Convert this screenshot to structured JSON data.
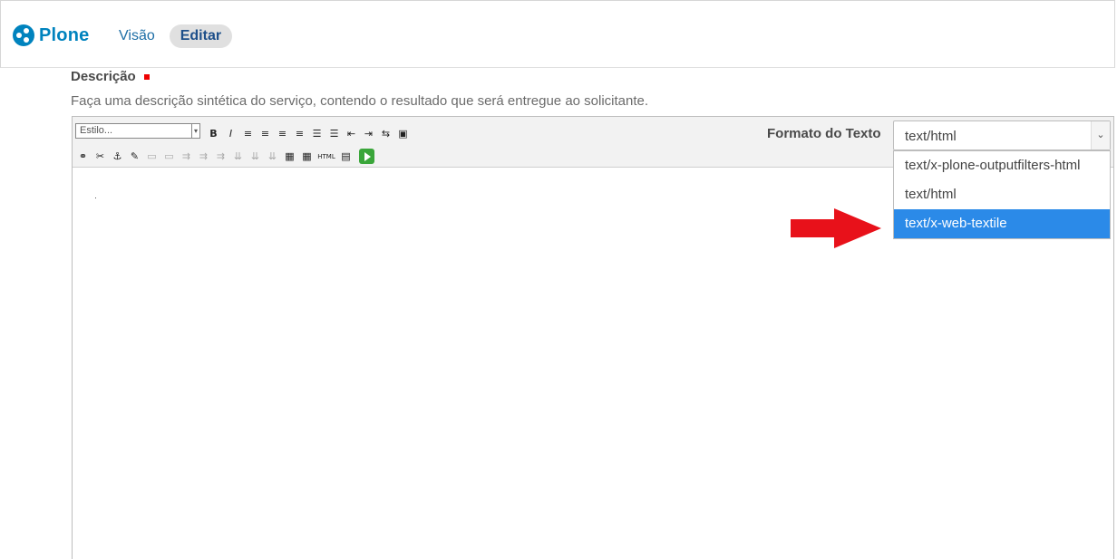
{
  "header": {
    "brand": "Plone",
    "nav": {
      "view": "Visão",
      "edit": "Editar"
    }
  },
  "field": {
    "label": "Descrição",
    "help": "Faça uma descrição sintética do serviço, contendo o resultado que será entregue ao solicitante."
  },
  "editor": {
    "style_placeholder": "Estilo...",
    "toolbar_row1": [
      "B",
      "I",
      "≡",
      "≡",
      "≡",
      "≡",
      "☰",
      "☰",
      "⇤",
      "⇥",
      "⇆",
      "▣"
    ],
    "toolbar_row1_names": [
      "bold-icon",
      "italic-icon",
      "align-left-icon",
      "align-center-icon",
      "align-right-icon",
      "align-justify-icon",
      "unordered-list-icon",
      "ordered-list-icon",
      "outdent-icon",
      "indent-icon",
      "definition-list-icon",
      "image-icon"
    ],
    "toolbar_row2": [
      "⚭",
      "✂",
      "⚓",
      "✎",
      "▭",
      "▭",
      "⇉",
      "⇉",
      "⇉",
      "⇊",
      "⇊",
      "⇊",
      "▦",
      "▦",
      "HTML",
      "▤"
    ],
    "toolbar_row2_names": [
      "link-icon",
      "unlink-icon",
      "anchor-icon",
      "edit-icon",
      "table-row-icon",
      "table-cell-icon",
      "insert-row-before-icon",
      "insert-row-after-icon",
      "delete-row-icon",
      "insert-col-before-icon",
      "insert-col-after-icon",
      "delete-col-icon",
      "table-icon",
      "table-props-icon",
      "html-source-icon",
      "fullscreen-icon"
    ]
  },
  "format": {
    "label": "Formato do Texto",
    "selected": "text/html",
    "options": [
      "text/x-plone-outputfilters-html",
      "text/html",
      "text/x-web-textile"
    ],
    "highlighted_index": 2
  },
  "colors": {
    "accent": "#0083be",
    "highlight": "#2b8ae8",
    "required": "#ee0000",
    "arrow": "#e8111a"
  }
}
